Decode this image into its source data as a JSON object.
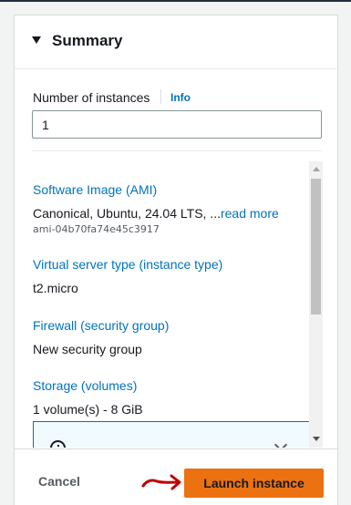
{
  "summary": {
    "title": "Summary"
  },
  "instances": {
    "label": "Number of instances",
    "info": "Info",
    "value": "1"
  },
  "sections": {
    "ami": {
      "label": "Software Image (AMI)",
      "value": "Canonical, Ubuntu, 24.04 LTS, ...",
      "read_more": "read more",
      "id": "ami-04b70fa74e45c3917"
    },
    "instance_type": {
      "label": "Virtual server type (instance type)",
      "value": "t2.micro"
    },
    "firewall": {
      "label": "Firewall (security group)",
      "value": "New security group"
    },
    "storage": {
      "label": "Storage (volumes)",
      "value": "1 volume(s) - 8 GiB"
    }
  },
  "footer": {
    "cancel": "Cancel",
    "launch": "Launch instance"
  },
  "colors": {
    "accent": "#ec7211",
    "link": "#0073bb",
    "annotation_arrow": "#c00000"
  },
  "icons": {
    "collapse": "caret-down-icon",
    "info_alert": "info-circle-icon",
    "expand": "chevron-down-icon",
    "pointer": "red-arrow-icon"
  }
}
